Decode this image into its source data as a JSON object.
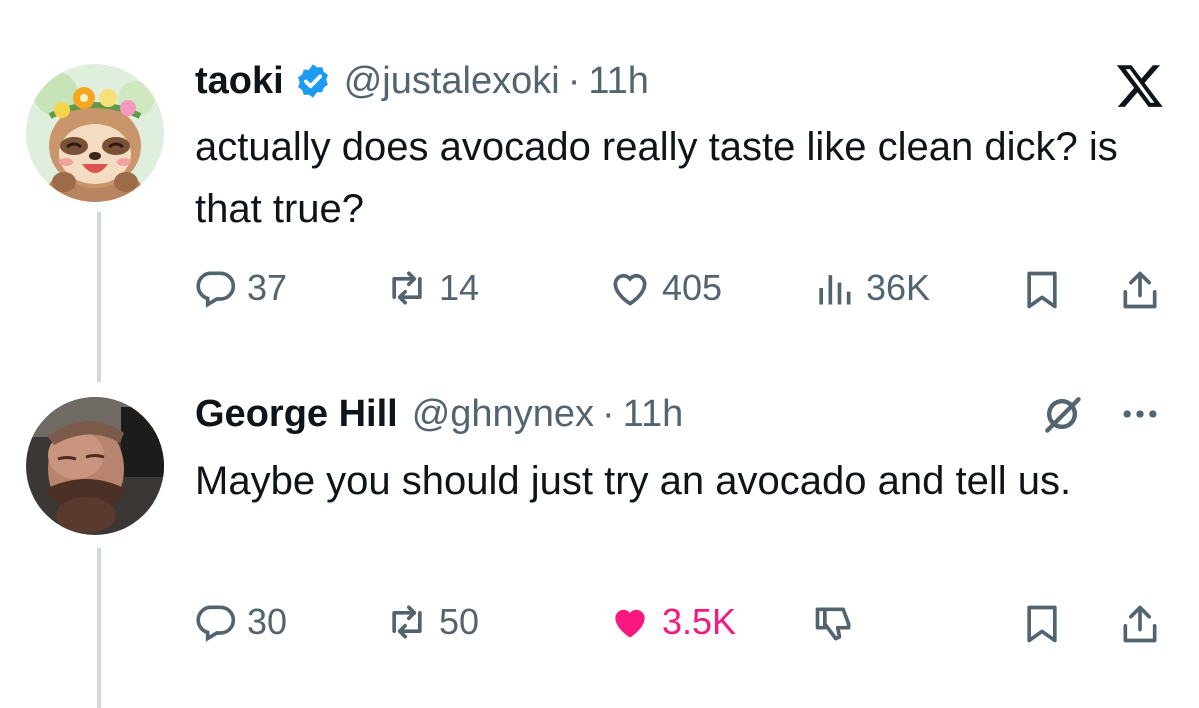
{
  "tweet": {
    "display_name": "taoki",
    "handle": "@justalexoki",
    "separator": "·",
    "time": "11h",
    "text": "actually does avocado really taste like clean dick? is that true?",
    "replies": "37",
    "retweets": "14",
    "likes": "405",
    "views": "36K",
    "verified": true
  },
  "reply": {
    "display_name": "George Hill",
    "handle": "@ghnynex",
    "separator": "·",
    "time": "11h",
    "text": "Maybe you should just try an avocado and tell us.",
    "replies": "30",
    "retweets": "50",
    "likes": "3.5K",
    "liked": true
  },
  "icons": {
    "platform": "x-logo-icon",
    "reply_more": "more-dots-icon",
    "grok": "grok-icon",
    "reply": "reply-icon",
    "retweet": "retweet-icon",
    "like": "heart-icon",
    "views": "views-icon",
    "bookmark": "bookmark-icon",
    "share": "share-icon",
    "dislike": "dislike-icon"
  },
  "colors": {
    "text": "#0f1419",
    "secondary": "#536471",
    "verified": "#1d9bf0",
    "like": "#f91880",
    "thread_line": "#cfd9de"
  }
}
